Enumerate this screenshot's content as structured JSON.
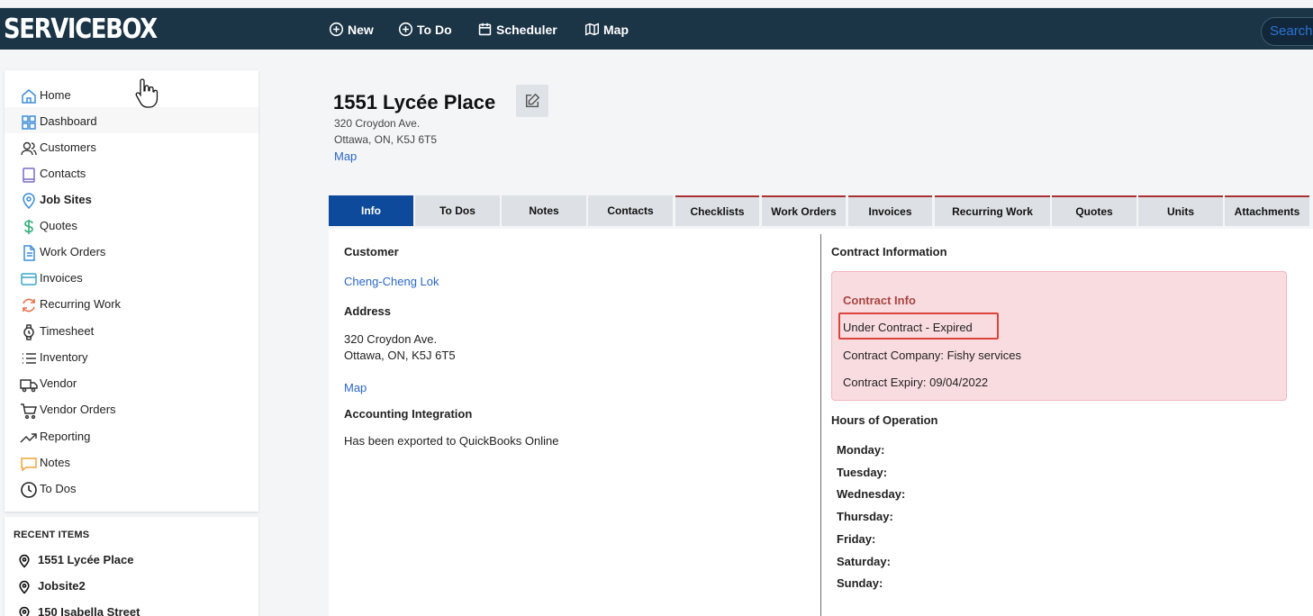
{
  "app": {
    "logo": "SERVICEBOX",
    "search_placeholder": "Search"
  },
  "topnav": [
    {
      "label": "New",
      "icon": "plus-circle-icon"
    },
    {
      "label": "To Do",
      "icon": "plus-circle-icon"
    },
    {
      "label": "Scheduler",
      "icon": "calendar-icon"
    },
    {
      "label": "Map",
      "icon": "map-icon"
    }
  ],
  "sidebar": {
    "items": [
      {
        "label": "Home",
        "icon": "home-icon"
      },
      {
        "label": "Dashboard",
        "icon": "dashboard-icon"
      },
      {
        "label": "Customers",
        "icon": "customers-icon"
      },
      {
        "label": "Contacts",
        "icon": "contacts-icon"
      },
      {
        "label": "Job Sites",
        "icon": "location-pin-icon"
      },
      {
        "label": "Quotes",
        "icon": "dollar-icon"
      },
      {
        "label": "Work Orders",
        "icon": "document-icon"
      },
      {
        "label": "Invoices",
        "icon": "credit-card-icon"
      },
      {
        "label": "Recurring Work",
        "icon": "refresh-icon"
      },
      {
        "label": "Timesheet",
        "icon": "watch-icon"
      },
      {
        "label": "Inventory",
        "icon": "list-icon"
      },
      {
        "label": "Vendor",
        "icon": "truck-icon"
      },
      {
        "label": "Vendor Orders",
        "icon": "cart-icon"
      },
      {
        "label": "Reporting",
        "icon": "trending-up-icon"
      },
      {
        "label": "Notes",
        "icon": "message-icon"
      },
      {
        "label": "To Dos",
        "icon": "clock-icon"
      }
    ]
  },
  "recent": {
    "title": "RECENT ITEMS",
    "items": [
      {
        "label": "1551 Lycée Place"
      },
      {
        "label": "Jobsite2"
      },
      {
        "label": "150 Isabella Street"
      }
    ]
  },
  "site": {
    "title": "1551 Lycée Place",
    "address_line1": "320 Croydon Ave.",
    "address_line2": "Ottawa, ON, K5J 6T5",
    "map_link": "Map"
  },
  "tabs": [
    "Info",
    "To Dos",
    "Notes",
    "Contacts",
    "Checklists",
    "Work Orders",
    "Invoices",
    "Recurring Work",
    "Quotes",
    "Units",
    "Attachments"
  ],
  "info": {
    "customer_label": "Customer",
    "customer_name": "Cheng-Cheng Lok",
    "address_label": "Address",
    "address_line1": "320 Croydon Ave.",
    "address_line2": "Ottawa, ON, K5J 6T5",
    "map_link": "Map",
    "accounting_label": "Accounting Integration",
    "accounting_status": "Has been exported to QuickBooks Online"
  },
  "contract": {
    "section_label": "Contract Information",
    "box_title": "Contract Info",
    "status": "Under Contract - Expired",
    "company": "Contract Company: Fishy services",
    "expiry": "Contract Expiry: 09/04/2022"
  },
  "hours": {
    "label": "Hours of Operation",
    "days": [
      "Monday:",
      "Tuesday:",
      "Wednesday:",
      "Thursday:",
      "Friday:",
      "Saturday:",
      "Sunday:"
    ]
  },
  "colors": {
    "topbar": "#1b3446",
    "tab_active": "#0d4a9b",
    "link": "#2a67c7",
    "contract_bg": "#f9dcdf",
    "highlight_border": "#d9443c"
  }
}
